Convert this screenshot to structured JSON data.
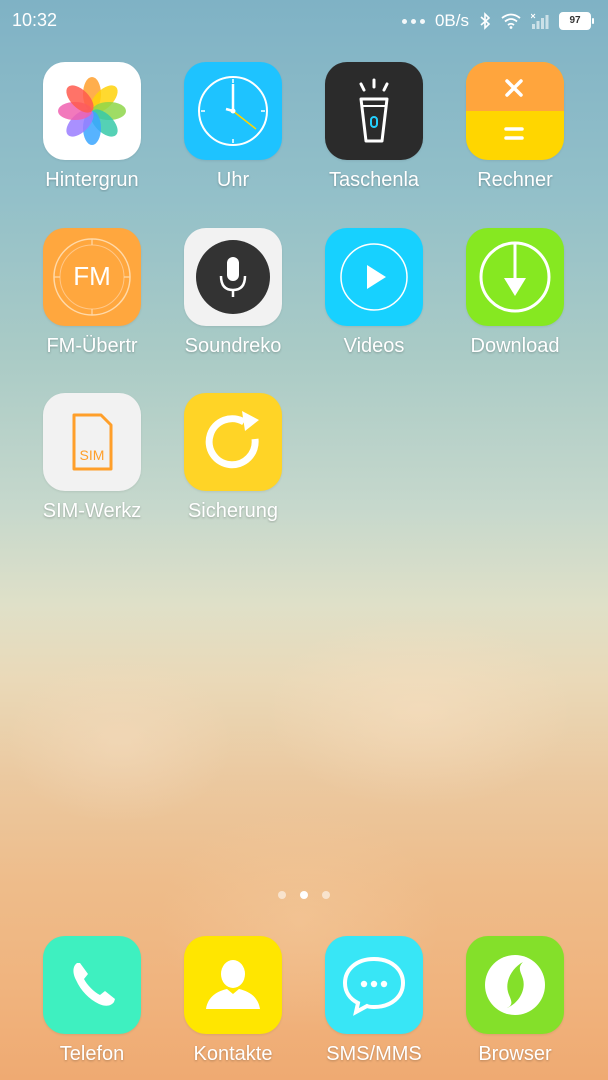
{
  "status_bar": {
    "time": "10:32",
    "network_speed": "0B/s",
    "battery": "97",
    "icons": [
      "more-dots-icon",
      "bluetooth-icon",
      "wifi-icon",
      "signal-icon",
      "battery-icon"
    ]
  },
  "apps": [
    {
      "label": "Hintergrun",
      "icon": "wallpaper-flower-icon"
    },
    {
      "label": "Uhr",
      "icon": "clock-icon"
    },
    {
      "label": "Taschenla",
      "icon": "flashlight-icon"
    },
    {
      "label": "Rechner",
      "icon": "calculator-icon"
    },
    {
      "label": "FM-Übertr",
      "icon": "fm-radio-icon",
      "text": "FM"
    },
    {
      "label": "Soundreko",
      "icon": "microphone-icon"
    },
    {
      "label": "Videos",
      "icon": "play-icon"
    },
    {
      "label": "Download",
      "icon": "download-icon"
    },
    {
      "label": "SIM-Werkz",
      "icon": "sim-card-icon",
      "text": "SIM"
    },
    {
      "label": "Sicherung",
      "icon": "backup-icon"
    }
  ],
  "page_indicator": {
    "count": 3,
    "active": 2
  },
  "dock": [
    {
      "label": "Telefon",
      "icon": "phone-icon"
    },
    {
      "label": "Kontakte",
      "icon": "contact-icon"
    },
    {
      "label": "SMS/MMS",
      "icon": "message-icon"
    },
    {
      "label": "Browser",
      "icon": "browser-icon"
    }
  ],
  "colors": {
    "clock": "#1ec3ff",
    "flashlight": "#2b2b2b",
    "calculator_top": "#ffa53d",
    "calculator_bottom": "#ffd600",
    "fm": "#ffa73e",
    "sound": "#f2f2f2",
    "videos": "#17d1ff",
    "download": "#86e821",
    "sim": "#f2f2f2",
    "backup": "#ffd426",
    "phone": "#3ef0c0",
    "contacts": "#ffe600",
    "sms": "#38e6f6",
    "browser": "#84e02a"
  }
}
